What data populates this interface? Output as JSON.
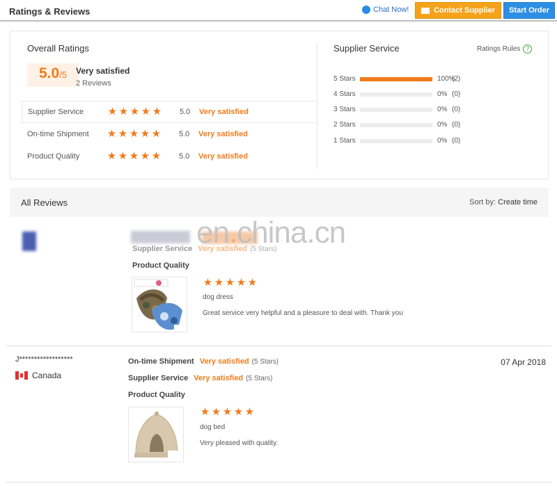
{
  "header": {
    "title": "Ratings & Reviews",
    "chat_label": "Chat Now!",
    "contact_label": "Contact Supplier",
    "order_label": "Start Order"
  },
  "overall": {
    "heading": "Overall Ratings",
    "score": "5.0",
    "score_den": "/5",
    "satisfaction": "Very satisfied",
    "review_count": "2 Reviews",
    "sub_ratings": [
      {
        "label": "Supplier Service",
        "value": "5.0",
        "word": "Very satisfied",
        "stars": 5
      },
      {
        "label": "On-time Shipment",
        "value": "5.0",
        "word": "Very satisfied",
        "stars": 5
      },
      {
        "label": "Product Quality",
        "value": "5.0",
        "word": "Very satisfied",
        "stars": 5
      }
    ]
  },
  "supplier_service": {
    "heading": "Supplier Service",
    "rules_label": "Ratings Rules",
    "distribution": [
      {
        "label": "5 Stars",
        "percent_text": "100%",
        "fraction": 1.0,
        "count": "(2)"
      },
      {
        "label": "4 Stars",
        "percent_text": "0%",
        "fraction": 0,
        "count": "(0)"
      },
      {
        "label": "3 Stars",
        "percent_text": "0%",
        "fraction": 0,
        "count": "(0)"
      },
      {
        "label": "2 Stars",
        "percent_text": "0%",
        "fraction": 0,
        "count": "(0)"
      },
      {
        "label": "1 Stars",
        "percent_text": "0%",
        "fraction": 0,
        "count": "(0)"
      }
    ]
  },
  "all_reviews": {
    "title": "All Reviews",
    "sort_label": "Sort by:",
    "sort_value": "Create time"
  },
  "watermark": "en.china.cn",
  "reviews": [
    {
      "lines": [
        {
          "label": "Supplier Service",
          "value": "Very satisfied",
          "note": "(5 Stars)"
        },
        {
          "label": "Product Quality",
          "value": "",
          "note": ""
        }
      ],
      "stars": 5,
      "product": "dog dress",
      "text": "Great service very helpful and a pleasure to deal with. Thank you"
    },
    {
      "reviewer": "J******************",
      "country": "Canada",
      "date": "07 Apr 2018",
      "lines": [
        {
          "label": "On-time Shipment",
          "value": "Very satisfied",
          "note": "(5 Stars)"
        },
        {
          "label": "Supplier Service",
          "value": "Very satisfied",
          "note": "(5 Stars)"
        },
        {
          "label": "Product Quality",
          "value": "",
          "note": ""
        }
      ],
      "stars": 5,
      "product": "dog bed",
      "text": "Very pleased with quality."
    }
  ],
  "colors": {
    "accent": "#f07b1a",
    "contact_button": "#f5a31a",
    "order_button": "#2d8fe3",
    "chat_link": "#2d6cbe"
  }
}
